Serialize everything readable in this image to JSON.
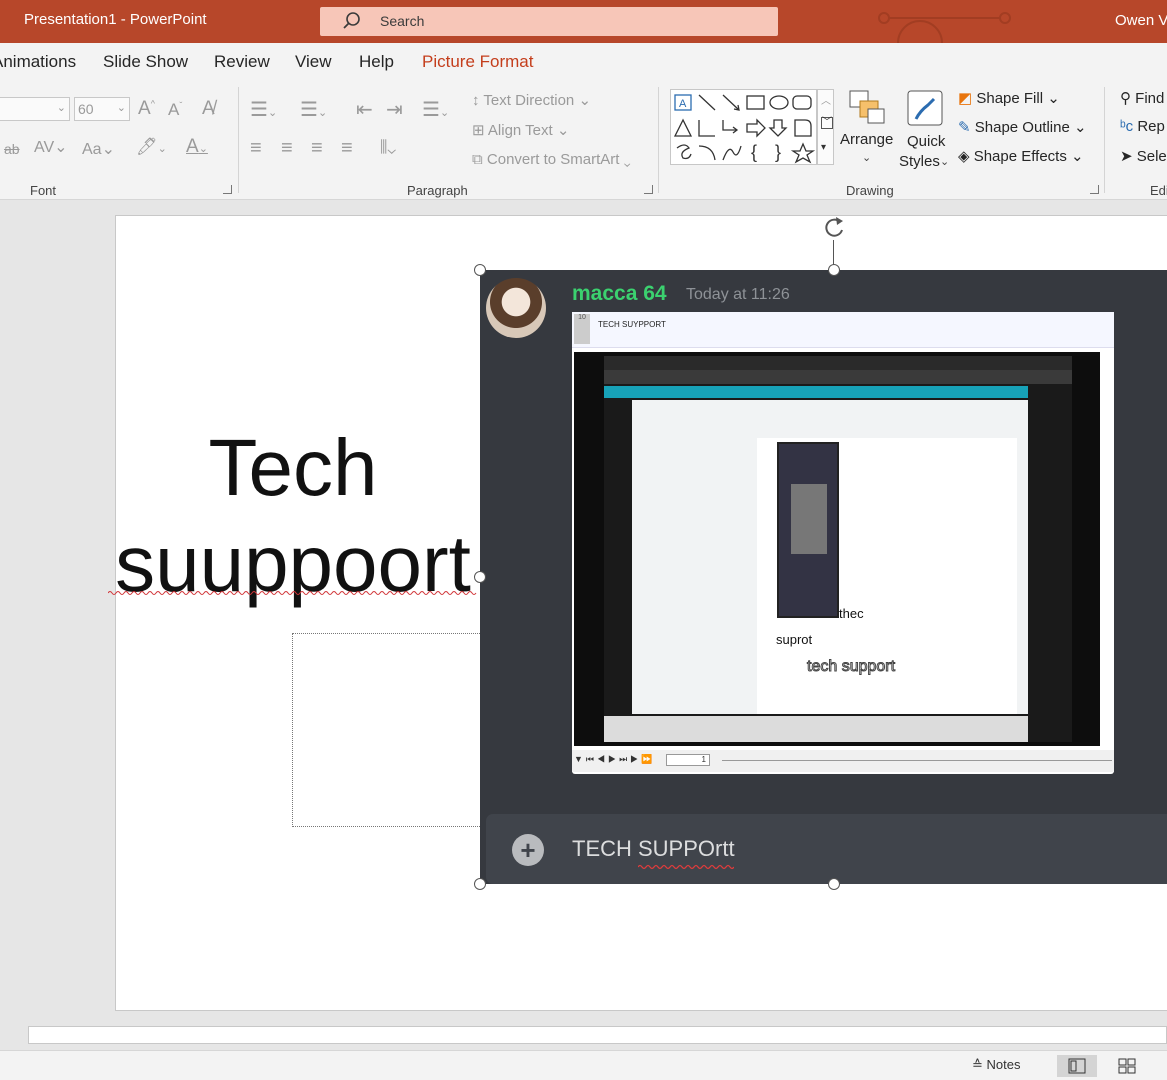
{
  "titlebar": {
    "title": "Presentation1  -  PowerPoint",
    "search_placeholder": "Search",
    "user": "Owen V"
  },
  "tabs": [
    {
      "label": "Animations"
    },
    {
      "label": "Slide Show"
    },
    {
      "label": "Review"
    },
    {
      "label": "View"
    },
    {
      "label": "Help"
    },
    {
      "label": "Picture Format"
    }
  ],
  "ribbon": {
    "font": {
      "font_size": "60",
      "group_label": "Font"
    },
    "paragraph": {
      "text_direction": "Text Direction",
      "align_text": "Align Text",
      "convert_smartart": "Convert to SmartArt",
      "group_label": "Paragraph"
    },
    "drawing": {
      "arrange": "Arrange",
      "quick_styles_line1": "Quick",
      "quick_styles_line2": "Styles",
      "shape_fill": "Shape Fill",
      "shape_outline": "Shape Outline",
      "shape_effects": "Shape Effects",
      "group_label": "Drawing"
    },
    "editing": {
      "find": "Find",
      "replace": "Rep",
      "select": "Sele",
      "group_label": "Edi"
    }
  },
  "slide": {
    "title_line1": "Tech",
    "title_line2": "suuppoort"
  },
  "picture": {
    "username": "macca 64",
    "timestamp": "Today at 11:26",
    "embed_line_number": "10",
    "embed_text": "TECH SUYPPORT",
    "nested_thec": "thec",
    "nested_suprot": "suprot",
    "nested_tech_support": "tech support",
    "video_frame": "1",
    "compose_text": "TECH SUPPOrtt"
  },
  "statusbar": {
    "notes_label": "Notes"
  },
  "colors": {
    "titlebar": "#b7472a",
    "active_tab": "#c43e1c",
    "discord_bg": "#36393f",
    "discord_username": "#3bd16f"
  }
}
